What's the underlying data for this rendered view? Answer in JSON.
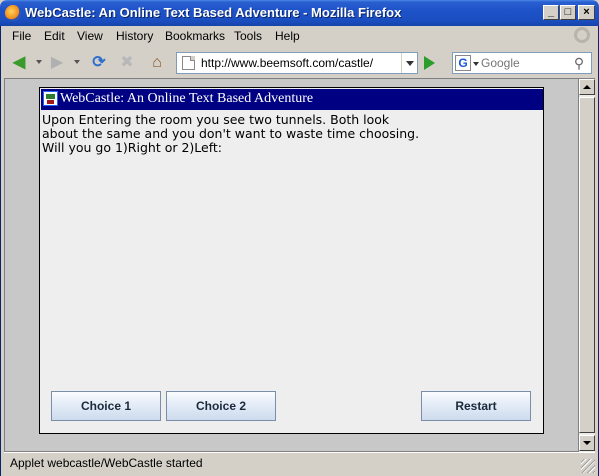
{
  "window": {
    "title": "WebCastle: An Online Text Based Adventure - Mozilla Firefox",
    "minimize": "_",
    "maximize": "□",
    "close": "×"
  },
  "menu": {
    "items": [
      "File",
      "Edit",
      "View",
      "History",
      "Bookmarks",
      "Tools",
      "Help"
    ]
  },
  "toolbar": {
    "url": "http://www.beemsoft.com/castle/",
    "search_placeholder": "Google",
    "search_engine_letter": "G"
  },
  "applet": {
    "title": "WebCastle: An Online Text Based Adventure",
    "story": "Upon Entering the room you see two tunnels. Both look\nabout the same and you don't want to waste time choosing.\nWill you go 1)Right or 2)Left:",
    "buttons": {
      "choice1": "Choice 1",
      "choice2": "Choice 2",
      "restart": "Restart"
    }
  },
  "status": {
    "text": "Applet webcastle/WebCastle started"
  },
  "icons": {
    "back": "back-arrow-icon",
    "forward": "forward-arrow-icon",
    "reload": "reload-icon",
    "stop": "stop-icon",
    "home": "home-icon",
    "go": "go-arrow-icon",
    "search": "magnifier-icon"
  },
  "colors": {
    "xp_titlebar": "#1e52c8",
    "applet_titlebar": "#000082",
    "go_green": "#2a9d2a"
  }
}
